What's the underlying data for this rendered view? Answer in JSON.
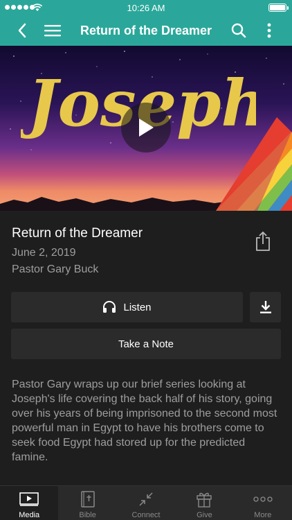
{
  "status_bar": {
    "time": "10:26 AM"
  },
  "nav": {
    "title": "Return of the Dreamer"
  },
  "hero": {
    "logo_text": "Joseph"
  },
  "sermon": {
    "title": "Return of the Dreamer",
    "date": "June 2, 2019",
    "speaker": "Pastor Gary Buck",
    "description": "Pastor Gary wraps up our brief series looking at Joseph's life covering the back half of his story, going over his years of being imprisoned to the second most powerful man in Egypt to have his brothers come to seek food Egypt had stored up for the predicted famine."
  },
  "actions": {
    "listen_label": "Listen",
    "note_label": "Take a Note"
  },
  "tabs": [
    {
      "label": "Media",
      "icon": "media-icon"
    },
    {
      "label": "Bible",
      "icon": "bible-icon"
    },
    {
      "label": "Connect",
      "icon": "connect-icon"
    },
    {
      "label": "Give",
      "icon": "gift-icon"
    },
    {
      "label": "More",
      "icon": "more-icon"
    }
  ],
  "colors": {
    "accent": "#2aa79a",
    "background": "#1e1e1e",
    "button": "#2b2b2b",
    "muted_text": "#9e9e9e"
  }
}
